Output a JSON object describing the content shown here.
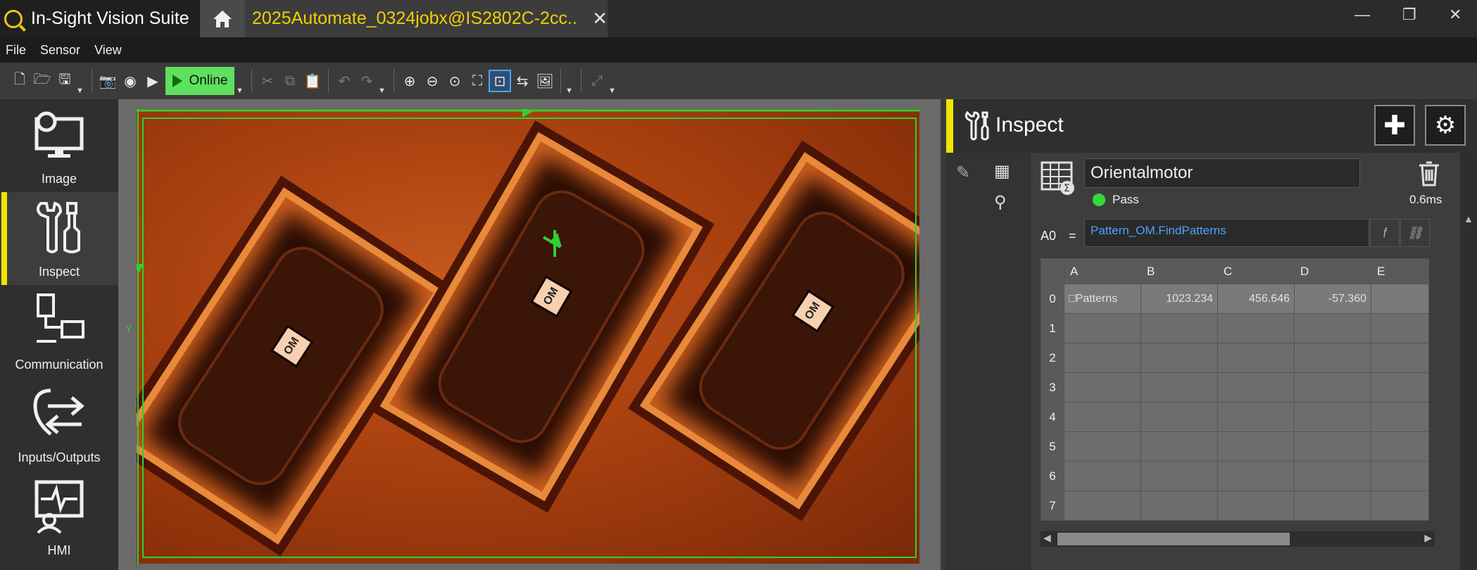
{
  "titlebar": {
    "app_name": "In-Sight Vision Suite",
    "doc_tab": "2025Automate_0324jobx@IS2802C-2cc...",
    "close_tab": "✕",
    "minimize": "—",
    "restore": "❐",
    "close_window": "✕"
  },
  "menu": [
    "File",
    "Sensor",
    "View"
  ],
  "toolbar": {
    "online_label": "Online"
  },
  "nav": {
    "items": [
      {
        "label": "Image"
      },
      {
        "label": "Inspect"
      },
      {
        "label": "Communication"
      },
      {
        "label": "Inputs/Outputs"
      },
      {
        "label": "HMI"
      }
    ]
  },
  "viewer": {
    "om_labels": [
      "OM",
      "OM",
      "OM"
    ],
    "axis_y": "Y"
  },
  "inspect": {
    "title": "Inspect",
    "job_name": "Orientalmotor",
    "status": "Pass",
    "time": "0.6ms",
    "cell_ref": "A0",
    "equals": "=",
    "formula": "Pattern_OM.FindPatterns",
    "fx_label": "f",
    "columns": [
      "A",
      "B",
      "C",
      "D",
      "E"
    ],
    "rows": [
      "0",
      "1",
      "2",
      "3",
      "4",
      "5",
      "6",
      "7"
    ],
    "row0": {
      "a": "□Patterns",
      "b": "1023.234",
      "c": "456.646",
      "d": "-57.360"
    },
    "colors": {
      "accent": "#f0e400",
      "pass": "#38d838",
      "roi": "#30d030",
      "formula": "#4aa3ff"
    }
  }
}
